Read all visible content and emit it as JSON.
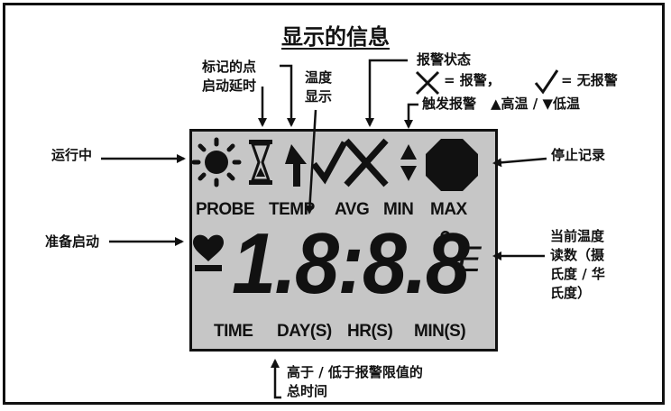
{
  "title": "显示的信息",
  "labels": {
    "marked_point": "标记的点",
    "start_delay": "启动延时",
    "temp_display_1": "温度",
    "temp_display_2": "显示",
    "alarm_status": "报警状态",
    "alarm_x_legend": "= 报警，",
    "alarm_check_legend": "= 无报警",
    "trigger_alarm": "触发报警",
    "high_low": "▲高温 / ▼低温",
    "running": "运行中",
    "stop_recording": "停止记录",
    "ready_to_start": "准备启动",
    "current_reading_1": "当前温度",
    "current_reading_2": "读数（摄",
    "current_reading_3": "氏度 / 华",
    "current_reading_4": "氏度）",
    "total_time_1": "高于 / 低于报警限值的",
    "total_time_2": "总时间"
  },
  "lcd": {
    "row_labels": [
      "PROBE",
      "TEMP",
      "AVG",
      "MIN",
      "MAX"
    ],
    "digits": "1.8:8.8",
    "degree": "°",
    "unit": "E",
    "time_labels": [
      "TIME",
      "DAY(S)",
      "HR(S)",
      "MIN(S)"
    ]
  },
  "icon_names": [
    "sun-icon",
    "hourglass-icon",
    "up-arrow-icon",
    "check-icon",
    "x-icon",
    "up-down-triangle-icon",
    "stop-octagon-icon",
    "heart-icon",
    "minus-sign-icon"
  ]
}
